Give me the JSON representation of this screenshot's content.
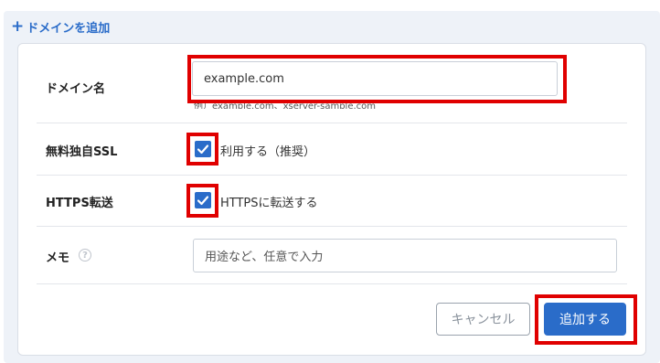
{
  "header": {
    "add_domain_label": "ドメインを追加"
  },
  "form": {
    "domain": {
      "label": "ドメイン名",
      "value": "example.com",
      "hint": "例）example.com、xserver-sample.com"
    },
    "ssl": {
      "label": "無料独自SSL",
      "checkbox_label": "利用する（推奨）",
      "checked": true
    },
    "https": {
      "label": "HTTPS転送",
      "checkbox_label": "HTTPSに転送する",
      "checked": true
    },
    "memo": {
      "label": "メモ",
      "help_icon_glyph": "?",
      "placeholder": "用途など、任意で入力"
    }
  },
  "actions": {
    "cancel_label": "キャンセル",
    "add_label": "追加する"
  },
  "colors": {
    "accent": "#2a6cc9",
    "highlight": "#e00000",
    "panel_bg": "#eef2f8"
  }
}
